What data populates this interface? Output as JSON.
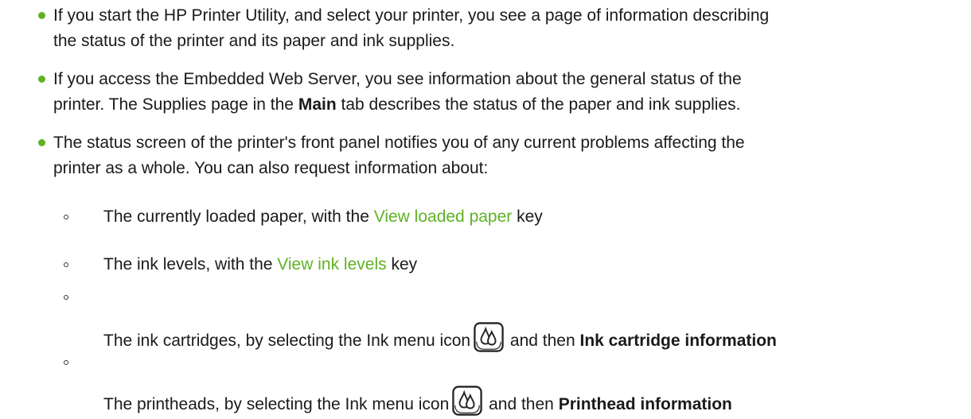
{
  "bullets": [
    {
      "line1": "If you start the HP Printer Utility, and select your printer, you see a page of information describing",
      "line2": "the status of the printer and its paper and ink supplies."
    },
    {
      "line1": "If you access the Embedded Web Server, you see information about the general status of the",
      "line2_pre": "printer. The Supplies page in the ",
      "line2_bold": "Main",
      "line2_post": " tab describes the status of the paper and ink supplies."
    },
    {
      "line1": "The status screen of the printer's front panel notifies you of any current problems affecting the",
      "line2": "printer as a whole. You can also request information about:"
    }
  ],
  "subitems": [
    {
      "pre": "The currently loaded paper, with the ",
      "link": "View loaded paper",
      "post": " key"
    },
    {
      "pre": "The ink levels, with the ",
      "link": "View ink levels",
      "post": " key"
    },
    {
      "pre": "The ink cartridges, by selecting the Ink menu icon",
      "icon": "ink-drops-icon",
      "mid": " and then ",
      "bold": "Ink cartridge information"
    },
    {
      "pre": "The printheads, by selecting the Ink menu icon",
      "icon": "ink-drops-icon",
      "mid": " and then ",
      "bold": "Printhead information"
    }
  ],
  "colors": {
    "bullet": "#5fb224",
    "link": "#5fb224",
    "text": "#1a1a1a"
  }
}
